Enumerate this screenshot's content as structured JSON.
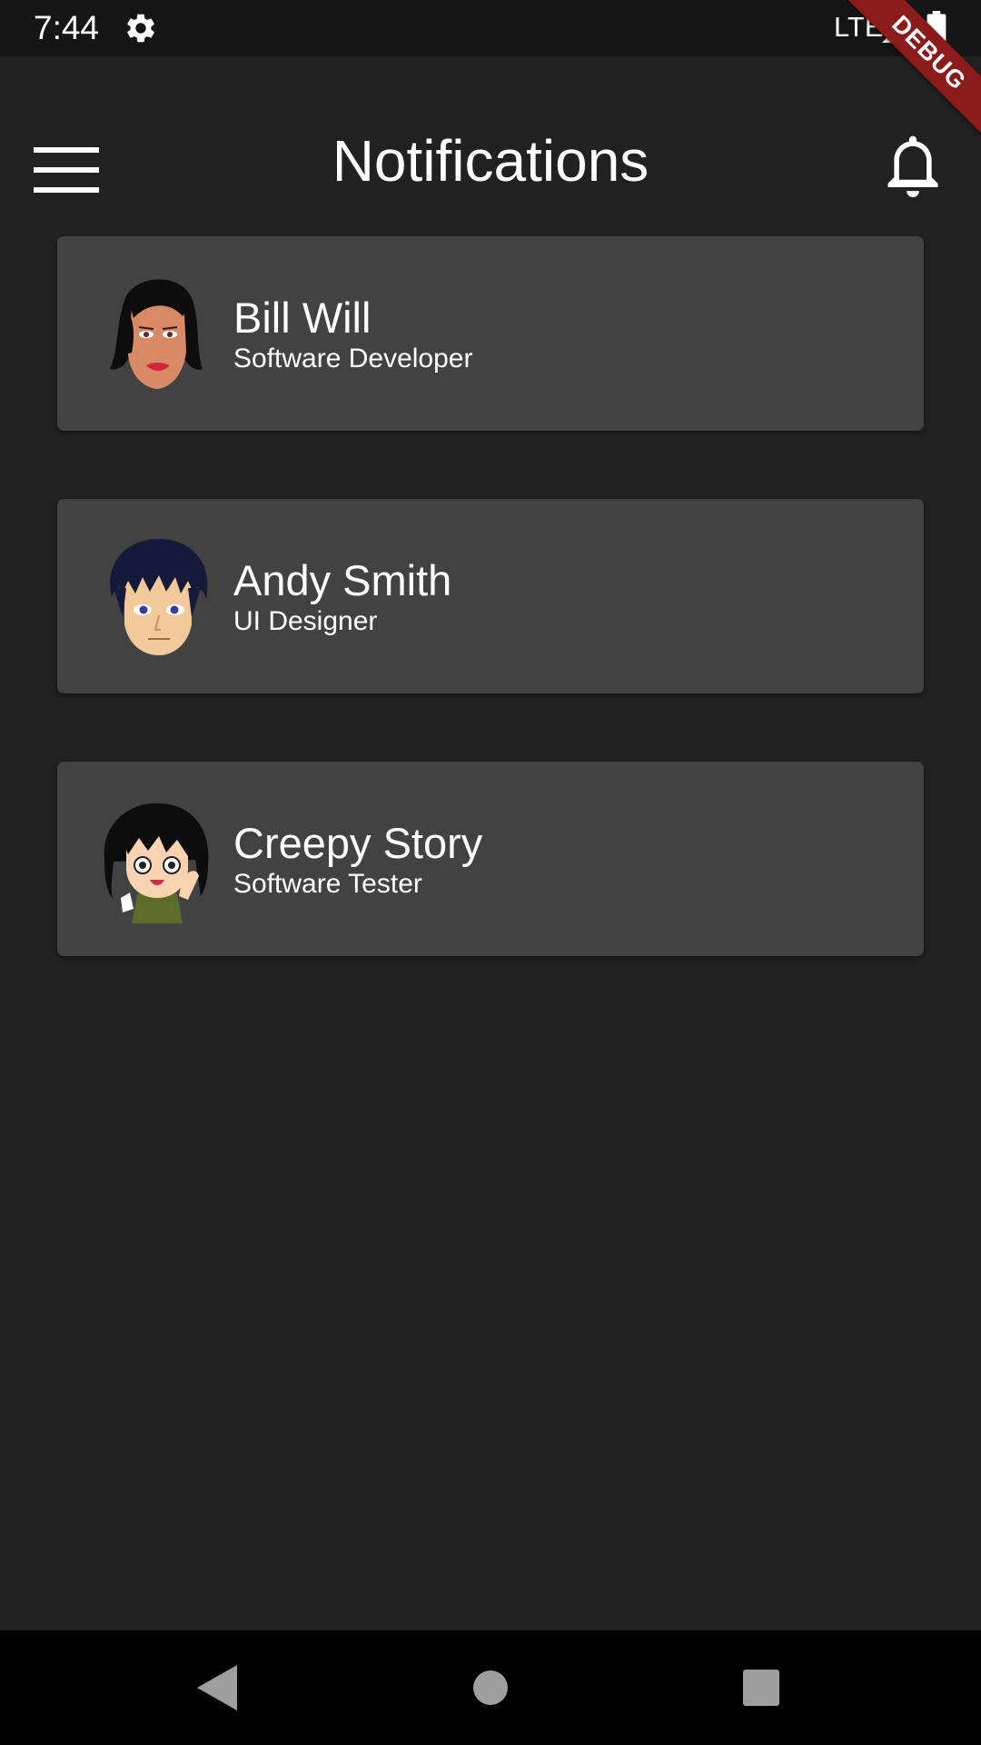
{
  "status_bar": {
    "time": "7:44",
    "network": "LTE",
    "icons": [
      "gear-icon",
      "signal-icon",
      "battery-icon"
    ]
  },
  "debug_banner": "DEBUG",
  "app_bar": {
    "title": "Notifications",
    "left_icon": "menu-icon",
    "right_icon": "bell-icon"
  },
  "notifications": [
    {
      "name": "Bill Will",
      "role": "Software Developer",
      "avatar": "woman-avatar"
    },
    {
      "name": "Andy Smith",
      "role": "UI Designer",
      "avatar": "man-avatar"
    },
    {
      "name": "Creepy Story",
      "role": "Software Tester",
      "avatar": "girl-avatar"
    }
  ],
  "nav_bar": {
    "icons": [
      "back-icon",
      "home-icon",
      "recents-icon"
    ]
  },
  "colors": {
    "background": "#212121",
    "card": "#424242",
    "status_bar": "#161616",
    "nav_bar": "#000000",
    "debug_ribbon": "#8b1a1a"
  }
}
